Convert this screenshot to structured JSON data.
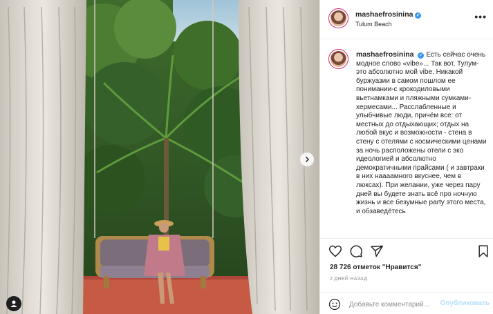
{
  "header": {
    "username": "mashaefrosinina",
    "location": "Tulum Beach",
    "more_label": "•••"
  },
  "caption": {
    "username": "mashaefrosinina",
    "text": "Есть сейчас очень модное слово «vibe»... Так вот, Тулум- это абсолютно мой vibe. Никакой буржуазии в самом пошлом ее понимании-с крокодиловыми вьетнамками и пляжными сумками-хермесами... Расслабленные и улыбчивые люди, причём все: от местных до отдыхающих; отдых на любой вкус и возможности - стена в стену с отелями с космическими ценами за ночь расположены отели с эко идеологией и абсолютно демократичными прайсами ( и завтраки в них наааамного вкуснее, чем в люксах). При желании, уже через пару дней вы будете знать всё про ночную жизнь и все безумные party этого места, и обзаведётесь"
  },
  "actions": {
    "like_icon": "heart-icon",
    "comment_icon": "comment-icon",
    "share_icon": "share-icon",
    "save_icon": "bookmark-icon"
  },
  "likes_text": "28 726 отметок \"Нравится\"",
  "date_text": "2 ДНЕЙ НАЗАД",
  "comment": {
    "placeholder": "Добавьте комментарий...",
    "publish_label": "Опубликовать"
  },
  "colors": {
    "accent": "#3897f0",
    "publish_disabled": "#b2dffc",
    "story_ring": "#d62976"
  }
}
